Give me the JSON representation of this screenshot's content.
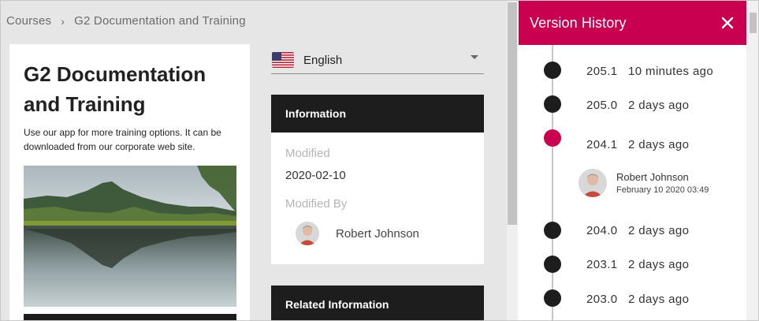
{
  "breadcrumb": {
    "items": [
      "Courses",
      "G2 Documentation and Training"
    ],
    "separator": "›"
  },
  "card": {
    "title": "G2 Documentation and Training",
    "description": "Use our app for more training options. It can be downloaded from our corporate web site.",
    "image_alt": "mountain-lake-landscape"
  },
  "language": {
    "selected": "English",
    "flag": "us-flag-icon"
  },
  "info": {
    "header": "Information",
    "modified_label": "Modified",
    "modified_value": "2020-02-10",
    "modified_by_label": "Modified By",
    "modified_by_name": "Robert Johnson"
  },
  "related": {
    "header": "Related Information"
  },
  "version_history": {
    "title": "Version History",
    "close_icon": "close-icon",
    "accent_color": "#c8004f",
    "versions": [
      {
        "version": "205.1",
        "time": "10 minutes ago"
      },
      {
        "version": "205.0",
        "time": "2 days ago"
      },
      {
        "version": "204.1",
        "time": "2 days ago",
        "active": true
      },
      {
        "version": "204.0",
        "time": "2 days ago"
      },
      {
        "version": "203.1",
        "time": "2 days ago"
      },
      {
        "version": "203.0",
        "time": "2 days ago"
      }
    ],
    "active_author": {
      "name": "Robert Johnson",
      "date": "February 10 2020 03:49"
    }
  }
}
